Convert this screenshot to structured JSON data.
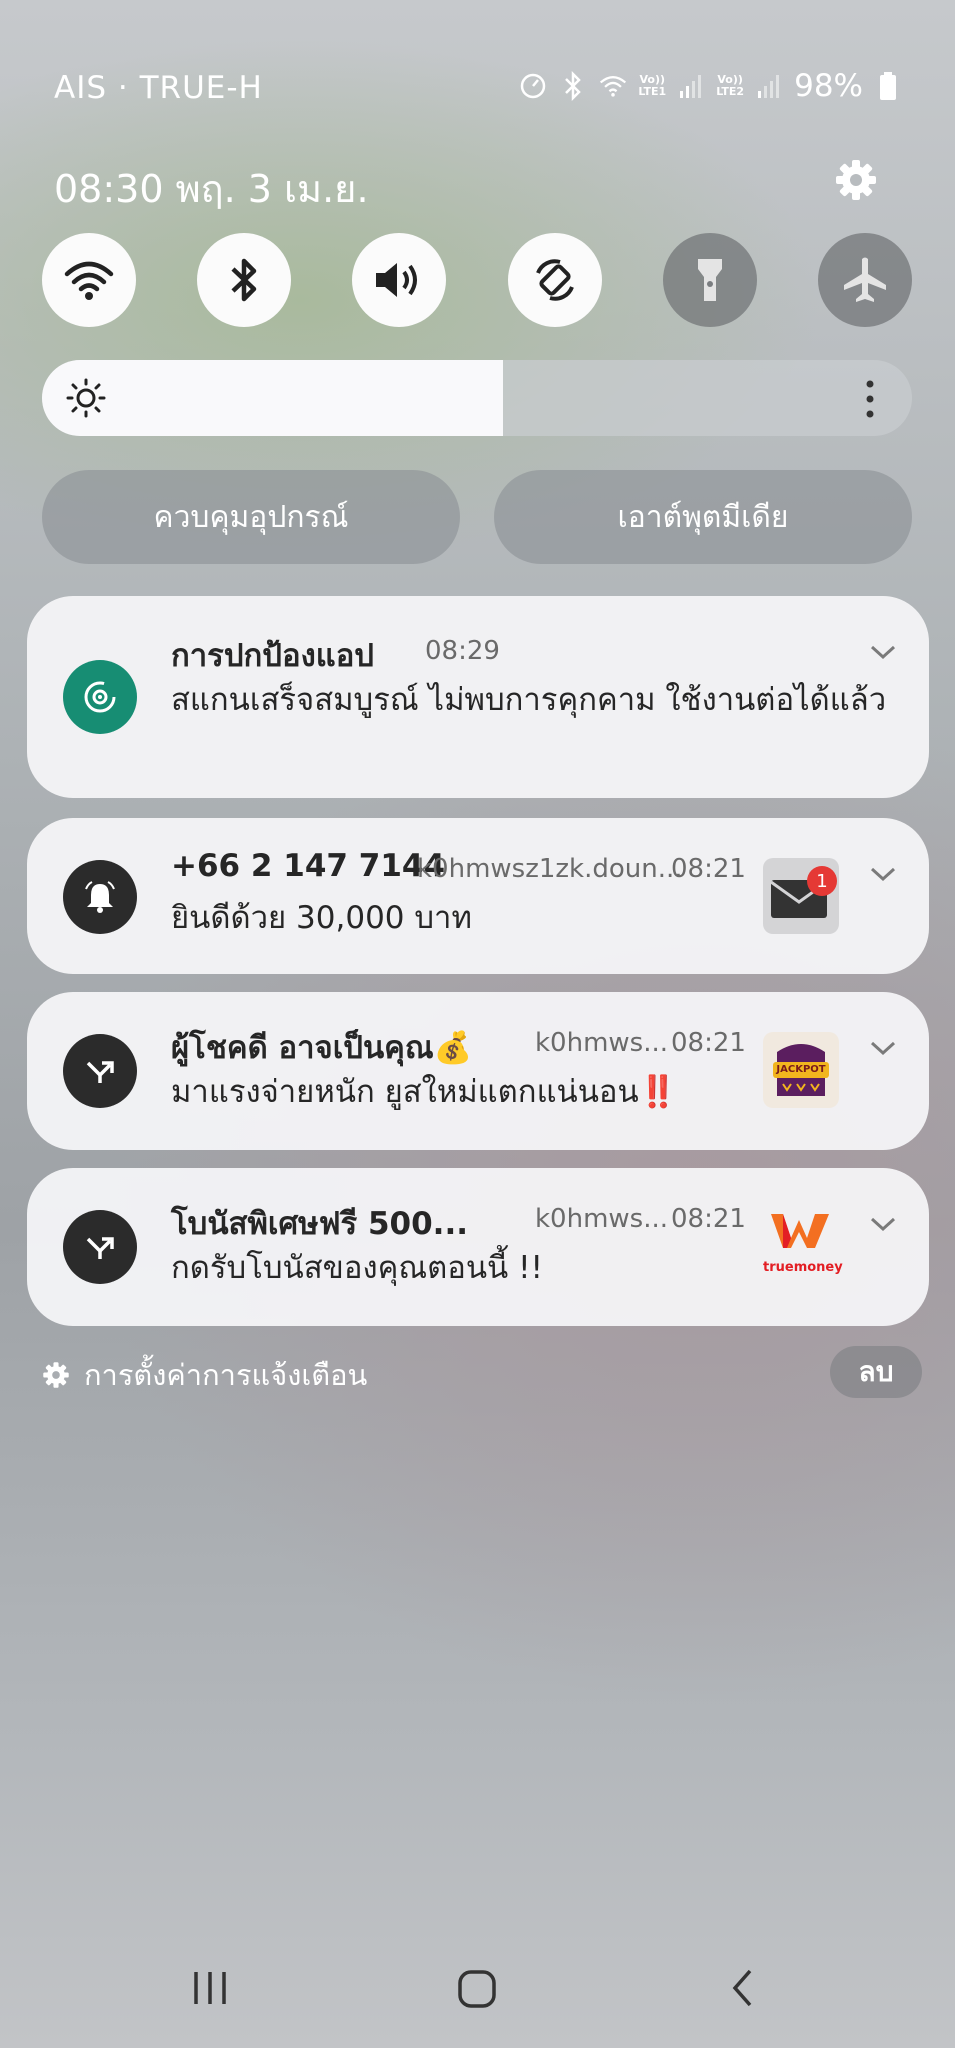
{
  "status_bar": {
    "carrier": "AIS · TRUE-H",
    "lte1": "LTE1",
    "lte2": "LTE2",
    "battery": "98%",
    "volte": "Vo))"
  },
  "panel": {
    "datetime": "08:30  พฤ. 3 เม.ย."
  },
  "quick_settings": [
    {
      "name": "wifi",
      "state": "on"
    },
    {
      "name": "bluetooth",
      "state": "on"
    },
    {
      "name": "sound",
      "state": "on"
    },
    {
      "name": "auto-rotate",
      "state": "on"
    },
    {
      "name": "flashlight",
      "state": "off"
    },
    {
      "name": "airplane-mode",
      "state": "off"
    }
  ],
  "brightness": {
    "level": 0.53
  },
  "buttons": {
    "device_control": "ควบคุมอุปกรณ์",
    "media_output": "เอาต์พุตมีเดีย"
  },
  "notifications": [
    {
      "title": "การปกป้องแอป",
      "source": "",
      "time": "08:29",
      "body": "สแกนเสร็จสมบูรณ์ ไม่พบการคุกคาม ใช้งานต่อได้แล้ว",
      "icon": "app-protection-icon"
    },
    {
      "title": "+66 2 147 7144",
      "source": "k0hmwsz1zk.doun...",
      "time": "08:21",
      "body": "ยินดีด้วย 30,000 บาท",
      "icon": "bell-icon",
      "thumb_badge": "1"
    },
    {
      "title": "ผู้โชคดี อาจเป็นคุณ💰",
      "source": "k0hmws...",
      "time": "08:21",
      "body": "มาแรงจ่ายหนัก ยูสใหม่แตกแน่นอน‼️",
      "icon": "merge-arrow-icon",
      "thumb_label": "JACKPOT"
    },
    {
      "title": "โบนัสพิเศษฟรี 500...",
      "source": "k0hmws...",
      "time": "08:21",
      "body": "กดรับโบนัสของคุณตอนนี้ !!",
      "icon": "merge-arrow-icon",
      "thumb_label": "truemoney"
    }
  ],
  "footer": {
    "notification_settings": "การตั้งค่าการแจ้งเตือน",
    "clear": "ลบ"
  },
  "colors": {
    "app_protection_green": "#178d73",
    "badge_red": "#e53935",
    "truemoney_orange": "#f36f21"
  }
}
